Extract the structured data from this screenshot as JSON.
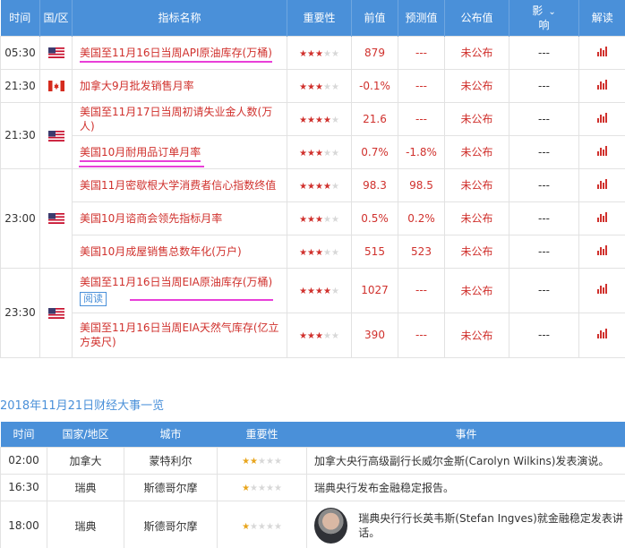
{
  "calendar": {
    "headers": {
      "time": "时间",
      "region": "国/区",
      "indicator": "指标名称",
      "importance": "重要性",
      "previous": "前值",
      "forecast": "预测值",
      "actual": "公布值",
      "impact_top": "影",
      "impact_bottom": "响",
      "explain": "解读"
    },
    "rows": [
      {
        "time": "05:30",
        "flag": "us",
        "name": "美国至11月16日当周API原油库存(万桶)",
        "stars": 3,
        "previous": "879",
        "forecast": "---",
        "actual": "未公布",
        "impact": "---"
      },
      {
        "time": "21:30",
        "flag": "ca",
        "name": "加拿大9月批发销售月率",
        "stars": 3,
        "previous": "-0.1%",
        "forecast": "---",
        "actual": "未公布",
        "impact": "---"
      },
      {
        "time": "21:30",
        "flag": "us",
        "name": "美国至11月17日当周初请失业金人数(万人)",
        "stars": 4,
        "previous": "21.6",
        "forecast": "---",
        "actual": "未公布",
        "impact": "---"
      },
      {
        "time": "",
        "flag": "",
        "name": "美国10月耐用品订单月率",
        "stars": 3,
        "previous": "0.7%",
        "forecast": "-1.8%",
        "actual": "未公布",
        "impact": "---"
      },
      {
        "time": "23:00",
        "flag": "us",
        "name": "美国11月密歇根大学消费者信心指数终值",
        "stars": 4,
        "previous": "98.3",
        "forecast": "98.5",
        "actual": "未公布",
        "impact": "---"
      },
      {
        "time": "",
        "flag": "",
        "name": "美国10月谘商会领先指标月率",
        "stars": 3,
        "previous": "0.5%",
        "forecast": "0.2%",
        "actual": "未公布",
        "impact": "---"
      },
      {
        "time": "",
        "flag": "",
        "name": "美国10月成屋销售总数年化(万户)",
        "stars": 3,
        "previous": "515",
        "forecast": "523",
        "actual": "未公布",
        "impact": "---"
      },
      {
        "time": "23:30",
        "flag": "us",
        "name": "美国至11月16日当周EIA原油库存(万桶)",
        "read_label": "阅读",
        "stars": 4,
        "previous": "1027",
        "forecast": "---",
        "actual": "未公布",
        "impact": "---"
      },
      {
        "time": "",
        "flag": "",
        "name": "美国至11月16日当周EIA天然气库存(亿立方英尺)",
        "stars": 3,
        "previous": "390",
        "forecast": "---",
        "actual": "未公布",
        "impact": "---"
      }
    ]
  },
  "events_section": {
    "title": "2018年11月21日财经大事一览",
    "headers": {
      "time": "时间",
      "region": "国家/地区",
      "city": "城市",
      "importance": "重要性",
      "event": "事件"
    },
    "rows": [
      {
        "time": "02:00",
        "region": "加拿大",
        "city": "蒙特利尔",
        "stars": 2,
        "event": "加拿大央行高级副行长威尔金斯(Carolyn Wilkins)发表演说。"
      },
      {
        "time": "16:30",
        "region": "瑞典",
        "city": "斯德哥尔摩",
        "stars": 1,
        "event": "瑞典央行发布金融稳定报告。"
      },
      {
        "time": "18:00",
        "region": "瑞典",
        "city": "斯德哥尔摩",
        "stars": 1,
        "event": "瑞典央行行长英韦斯(Stefan Ingves)就金融稳定发表讲话。"
      }
    ]
  },
  "colors": {
    "header_blue": "#4a90d9",
    "red": "#d0312d",
    "highlight": "#e83fd8",
    "star_yellow": "#e8a51d"
  }
}
